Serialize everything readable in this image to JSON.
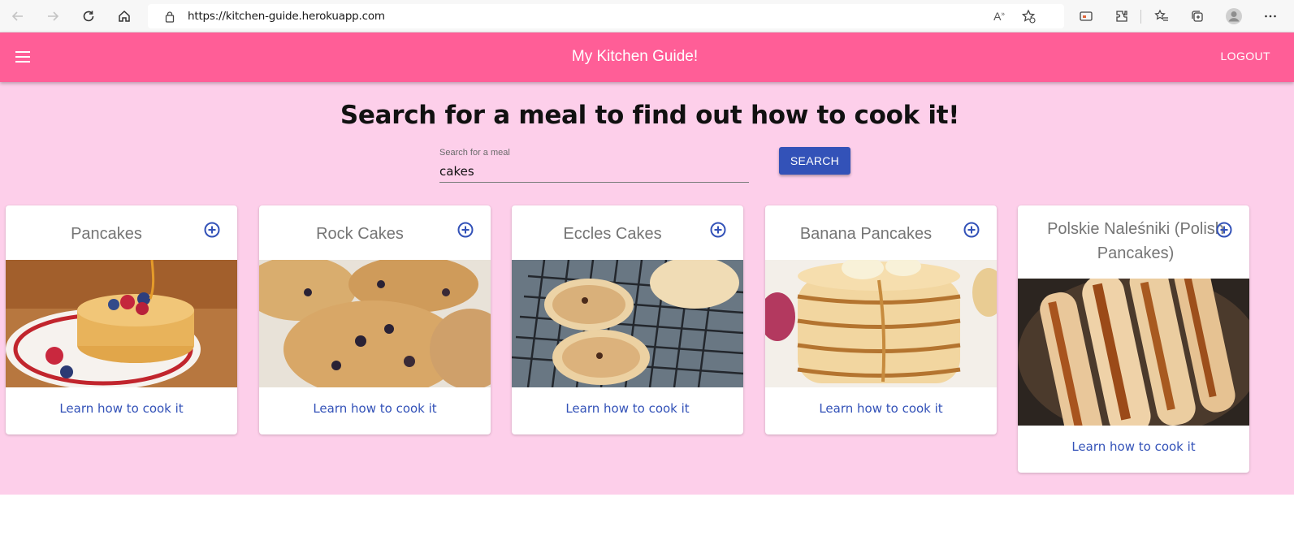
{
  "browser": {
    "url": "https://kitchen-guide.herokuapp.com"
  },
  "appbar": {
    "title": "My Kitchen Guide!",
    "logout_label": "LOGOUT"
  },
  "main": {
    "heading": "Search for a meal to find out how to cook it!",
    "search": {
      "label": "Search for a meal",
      "value": "cakes",
      "button_label": "SEARCH"
    },
    "meals": [
      {
        "title": "Pancakes",
        "link": "Learn how to cook it"
      },
      {
        "title": "Rock Cakes",
        "link": "Learn how to cook it"
      },
      {
        "title": "Eccles Cakes",
        "link": "Learn how to cook it"
      },
      {
        "title": "Banana Pancakes",
        "link": "Learn how to cook it"
      },
      {
        "title": "Polskie Naleśniki (Polish Pancakes)",
        "link": "Learn how to cook it"
      }
    ]
  },
  "colors": {
    "appbar": "#ff5e97",
    "background": "#fdcfea",
    "primary": "#3352b8"
  }
}
